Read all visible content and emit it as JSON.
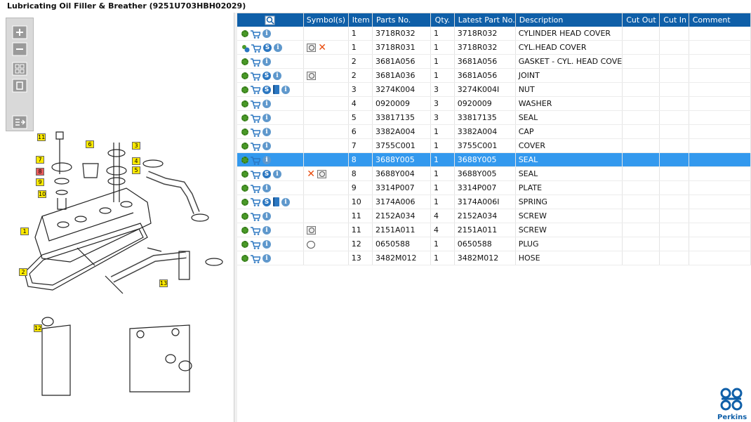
{
  "title": "Lubricating Oil Filler & Breather (9251U703HBH02029)",
  "toolbar": {
    "zoom_in": "+",
    "zoom_out": "−"
  },
  "diagram_labels": [
    "11",
    "7",
    "8",
    "9",
    "10",
    "6",
    "3",
    "4",
    "5",
    "1",
    "2",
    "13",
    "12"
  ],
  "table": {
    "headers": [
      "Symbol(s)",
      "Item",
      "Parts No.",
      "Qty.",
      "Latest Part No.",
      "Description",
      "Cut Out",
      "Cut In",
      "Comment"
    ],
    "rows": [
      {
        "icons": [
          "gear",
          "cart",
          "info"
        ],
        "symbols": [],
        "item": "1",
        "part": "3718R032",
        "qty": "1",
        "latest": "3718R032",
        "desc": "CYLINDER HEAD COVER"
      },
      {
        "icons": [
          "gear2",
          "cart",
          "s",
          "info"
        ],
        "symbols": [
          "magic",
          "x"
        ],
        "item": "1",
        "part": "3718R031",
        "qty": "1",
        "latest": "3718R032",
        "desc": "CYL.HEAD COVER"
      },
      {
        "icons": [
          "gear",
          "cart",
          "info"
        ],
        "symbols": [],
        "item": "2",
        "part": "3681A056",
        "qty": "1",
        "latest": "3681A056",
        "desc": "GASKET - CYL. HEAD COVE"
      },
      {
        "icons": [
          "gear",
          "cart",
          "s",
          "info"
        ],
        "symbols": [
          "magic"
        ],
        "item": "2",
        "part": "3681A036",
        "qty": "1",
        "latest": "3681A056",
        "desc": "JOINT"
      },
      {
        "icons": [
          "gear",
          "cart",
          "s",
          "book",
          "info"
        ],
        "symbols": [],
        "item": "3",
        "part": "3274K004",
        "qty": "3",
        "latest": "3274K004I",
        "desc": "NUT"
      },
      {
        "icons": [
          "gear",
          "cart",
          "info"
        ],
        "symbols": [],
        "item": "4",
        "part": "0920009",
        "qty": "3",
        "latest": "0920009",
        "desc": "WASHER"
      },
      {
        "icons": [
          "gear",
          "cart",
          "info"
        ],
        "symbols": [],
        "item": "5",
        "part": "33817135",
        "qty": "3",
        "latest": "33817135",
        "desc": "SEAL"
      },
      {
        "icons": [
          "gear",
          "cart",
          "info"
        ],
        "symbols": [],
        "item": "6",
        "part": "3382A004",
        "qty": "1",
        "latest": "3382A004",
        "desc": "CAP"
      },
      {
        "icons": [
          "gear",
          "cart",
          "info"
        ],
        "symbols": [],
        "item": "7",
        "part": "3755C001",
        "qty": "1",
        "latest": "3755C001",
        "desc": "COVER"
      },
      {
        "icons": [
          "gear",
          "cart",
          "info"
        ],
        "symbols": [],
        "item": "8",
        "part": "3688Y005",
        "qty": "1",
        "latest": "3688Y005",
        "desc": "SEAL",
        "selected": true
      },
      {
        "icons": [
          "gear",
          "cart",
          "s",
          "info"
        ],
        "symbols": [
          "x",
          "magic"
        ],
        "item": "8",
        "part": "3688Y004",
        "qty": "1",
        "latest": "3688Y005",
        "desc": "SEAL"
      },
      {
        "icons": [
          "gear",
          "cart",
          "info"
        ],
        "symbols": [],
        "item": "9",
        "part": "3314P007",
        "qty": "1",
        "latest": "3314P007",
        "desc": "PLATE"
      },
      {
        "icons": [
          "gear",
          "cart",
          "s",
          "book",
          "info"
        ],
        "symbols": [],
        "item": "10",
        "part": "3174A006",
        "qty": "1",
        "latest": "3174A006I",
        "desc": "SPRING"
      },
      {
        "icons": [
          "gear",
          "cart",
          "info"
        ],
        "symbols": [],
        "item": "11",
        "part": "2152A034",
        "qty": "4",
        "latest": "2152A034",
        "desc": "SCREW"
      },
      {
        "icons": [
          "gear",
          "cart",
          "info"
        ],
        "symbols": [
          "magic"
        ],
        "item": "11",
        "part": "2151A011",
        "qty": "4",
        "latest": "2151A011",
        "desc": "SCREW"
      },
      {
        "icons": [
          "gear",
          "cart",
          "info"
        ],
        "symbols": [
          "note"
        ],
        "item": "12",
        "part": "0650588",
        "qty": "1",
        "latest": "0650588",
        "desc": "PLUG"
      },
      {
        "icons": [
          "gear",
          "cart",
          "info"
        ],
        "symbols": [],
        "item": "13",
        "part": "3482M012",
        "qty": "1",
        "latest": "3482M012",
        "desc": "HOSE"
      }
    ]
  },
  "logo": {
    "text": "Perkins"
  },
  "colors": {
    "header": "#0f5fa8",
    "selected": "#3399ee",
    "accent": "#2b77c1"
  }
}
